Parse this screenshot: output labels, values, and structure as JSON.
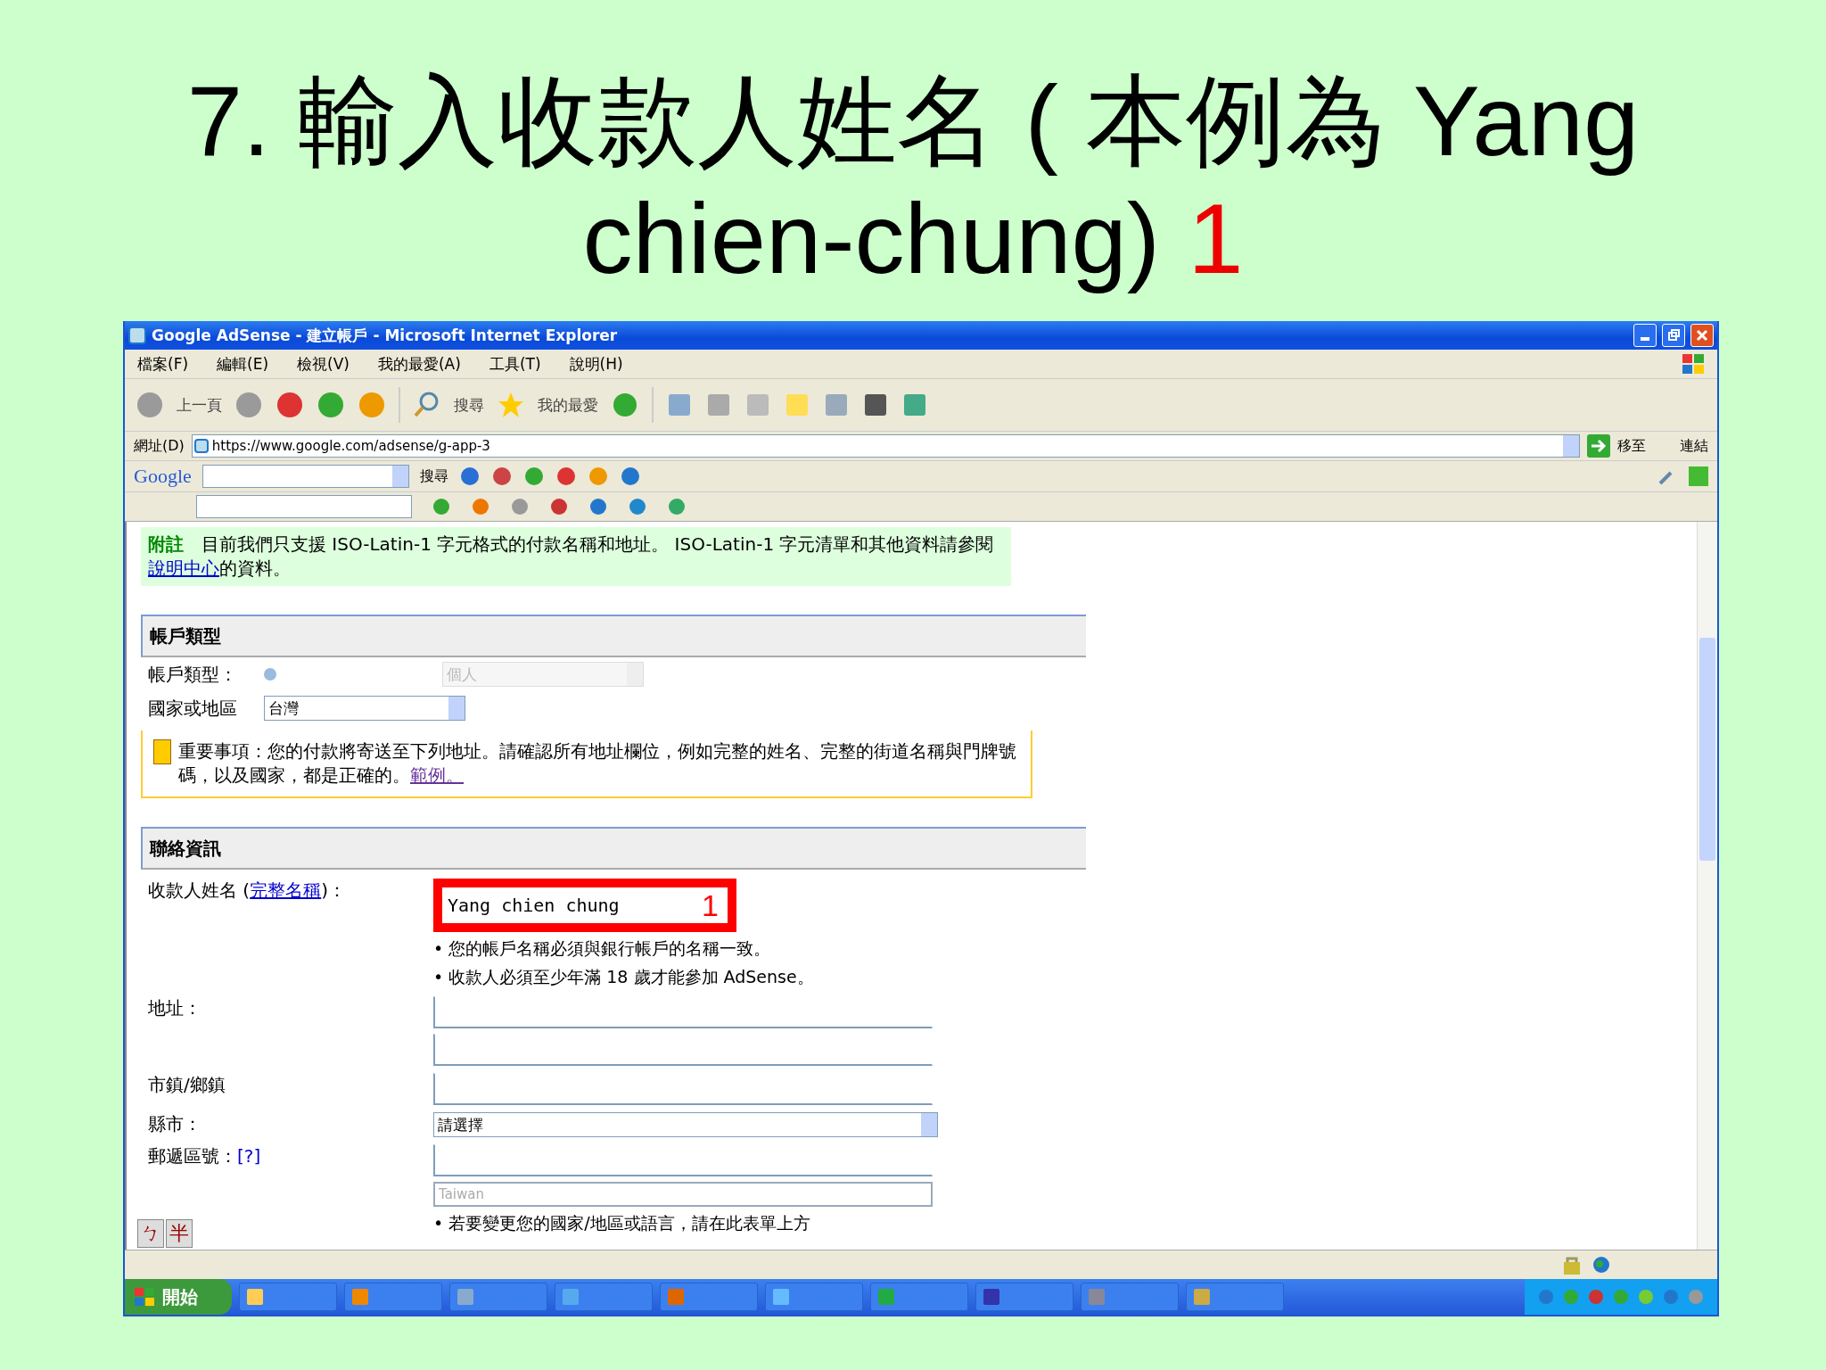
{
  "slide": {
    "title_lines": [
      "7. 輸入收款人姓名 ( 本例為 Yang",
      "chien-chung)"
    ],
    "title_marker": "1"
  },
  "window": {
    "title": "Google AdSense - 建立帳戶 - Microsoft Internet Explorer"
  },
  "menu": [
    "檔案(F)",
    "編輯(E)",
    "檢視(V)",
    "我的最愛(A)",
    "工具(T)",
    "說明(H)"
  ],
  "toolbar": {
    "back": "上一頁",
    "search": "搜尋",
    "favorites": "我的最愛"
  },
  "address_bar": {
    "label": "網址(D)",
    "value": "https://www.google.com/adsense/g-app-3",
    "go": "移至",
    "links": "連結"
  },
  "google_toolbar": {
    "logo": "Google",
    "search": "搜尋"
  },
  "page": {
    "note": {
      "label": "附註",
      "text": "目前我們只支援 ISO-Latin-1 字元格式的付款名稱和地址。 ISO-Latin-1 字元清單",
      "text2_before": "和其他資料請參閱",
      "link": "說明中心",
      "text2_after": "的資料。"
    },
    "account_section": {
      "title": "帳戶類型",
      "rows": [
        {
          "label": "帳戶類型：",
          "value": "個人",
          "disabled": true
        },
        {
          "label": "國家或地區",
          "value": "台灣",
          "disabled": false
        }
      ]
    },
    "warning": {
      "text": "重要事項：您的付款將寄送至下列地址。請確認所有地址欄位，例如完整的姓名、完整的街道名稱與門牌號碼，以及國家，都是正確的。",
      "link": "範例。"
    },
    "contact_section": {
      "title": "聯絡資訊",
      "payee": {
        "label": "收款人姓名 (",
        "link": "完整名稱",
        "label_end": ")：",
        "value": "Yang chien chung",
        "marker": "1",
        "hints": [
          "• 您的帳戶名稱必須與銀行帳戶的名稱一致。",
          "• 收款人必須至少年滿 18 歲才能參加 AdSense。"
        ]
      },
      "address_label": "地址：",
      "city_label": "市鎮/鄉鎮",
      "county": {
        "label": "縣市：",
        "value": "請選擇"
      },
      "zip": {
        "label": "郵遞區號：",
        "help": "[?]"
      },
      "country_field": {
        "placeholder": "Taiwan"
      },
      "country_hint": "• 若要變更您的國家/地區或語言，請在此表單上方"
    },
    "ime": [
      "ㄅ",
      "半"
    ]
  },
  "start_button": "開始"
}
